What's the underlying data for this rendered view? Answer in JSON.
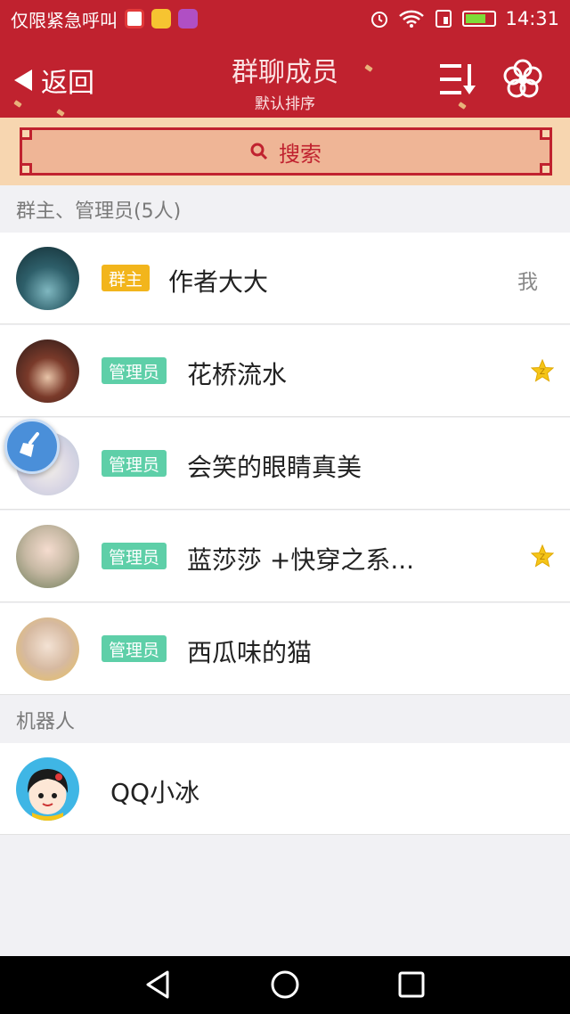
{
  "status_bar": {
    "carrier": "仅限紧急呼叫",
    "time": "14:31"
  },
  "header": {
    "back_label": "返回",
    "title": "群聊成员",
    "subtitle": "默认排序"
  },
  "search": {
    "label": "搜索"
  },
  "sections": {
    "admins": {
      "title": "群主、管理员(5人)",
      "members": [
        {
          "name": "作者大大",
          "badge": "群主",
          "extra": "我"
        },
        {
          "name": "花桥流水",
          "badge": "管理员"
        },
        {
          "name": "会笑的眼睛真美",
          "badge": "管理员"
        },
        {
          "name": "蓝莎莎 +快穿之系...",
          "badge": "管理员"
        },
        {
          "name": "西瓜味的猫",
          "badge": "管理员"
        }
      ]
    },
    "bots": {
      "title": "机器人",
      "members": [
        {
          "name": "QQ小冰"
        }
      ]
    }
  },
  "colors": {
    "brand_red": "#c0222f",
    "owner_badge": "#f2b51c",
    "admin_badge": "#5ecfa8",
    "search_band": "#f7d6b0"
  },
  "icons": [
    "back-arrow-icon",
    "sort-icon",
    "flower-settings-icon",
    "search-icon",
    "star-icon",
    "broom-clean-icon",
    "nav-back-icon",
    "nav-home-icon",
    "nav-recents-icon"
  ]
}
